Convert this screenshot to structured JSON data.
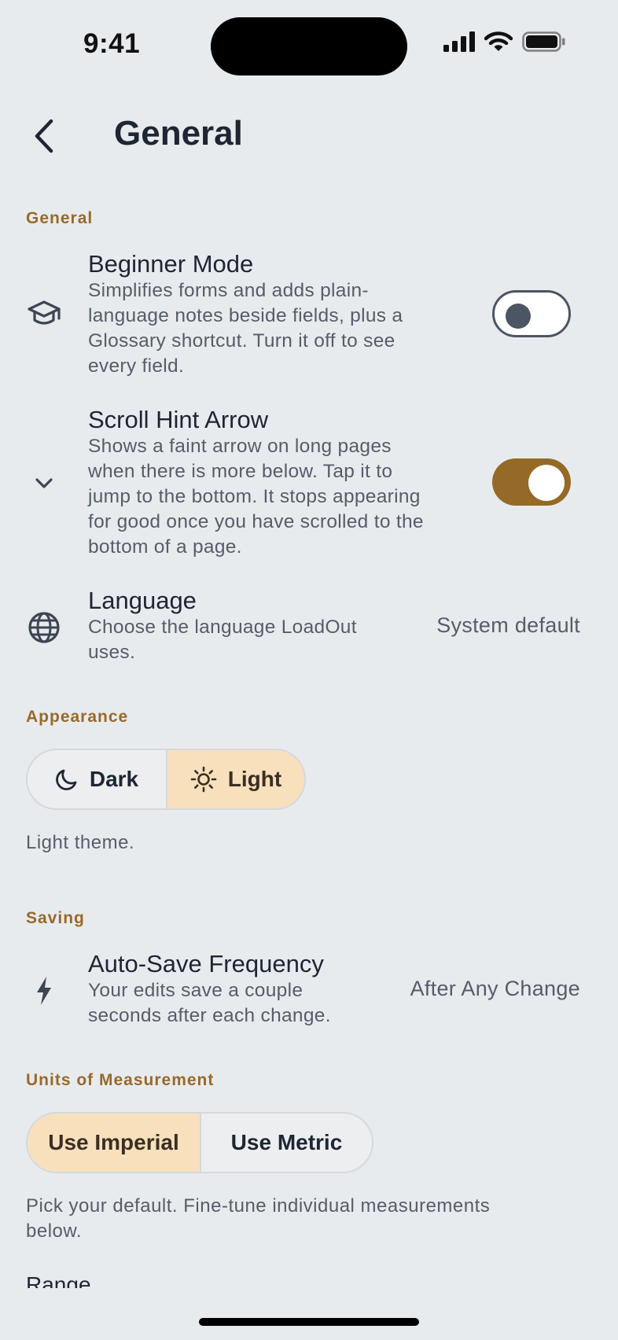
{
  "status_bar": {
    "time": "9:41"
  },
  "header": {
    "title": "General"
  },
  "sections": {
    "general": "General",
    "appearance": "Appearance",
    "saving": "Saving",
    "units": "Units of Measurement"
  },
  "general_rows": {
    "beginner": {
      "icon": "graduation-cap-icon",
      "title": "Beginner Mode",
      "desc": [
        "Simplifies forms and adds plain-",
        "language notes beside fields, plus a",
        "Glossary shortcut. Turn it off to see",
        "every field."
      ],
      "enabled": false
    },
    "scroll_hint": {
      "icon": "chevron-down-icon",
      "title": "Scroll Hint Arrow",
      "desc": [
        "Shows a faint arrow on long pages",
        "when there is more below. Tap it to",
        "jump to the bottom. It stops appearing",
        "for good once you have scrolled to the",
        "bottom of a page."
      ],
      "enabled": true
    },
    "language": {
      "icon": "globe-icon",
      "title": "Language",
      "desc": [
        "Choose the language LoadOut",
        "uses."
      ],
      "value": "System default"
    }
  },
  "appearance": {
    "options": [
      {
        "label": "Dark",
        "icon": "moon-icon",
        "selected": false
      },
      {
        "label": "Light",
        "icon": "sun-icon",
        "selected": true
      }
    ],
    "helper": "Light theme."
  },
  "saving": {
    "autosave": {
      "icon": "bolt-icon",
      "title": "Auto-Save Frequency",
      "desc": [
        "Your edits save a couple",
        "seconds after each change."
      ],
      "value": "After Any Change"
    }
  },
  "units": {
    "options": [
      {
        "label": "Use Imperial",
        "selected": true
      },
      {
        "label": "Use Metric",
        "selected": false
      }
    ],
    "helper": [
      "Pick your default. Fine-tune individual measurements",
      "below."
    ],
    "next_label": "Range"
  },
  "colors": {
    "accent": "#956a26",
    "selected_bg": "#f8e0bd",
    "background": "#e8ebee"
  }
}
